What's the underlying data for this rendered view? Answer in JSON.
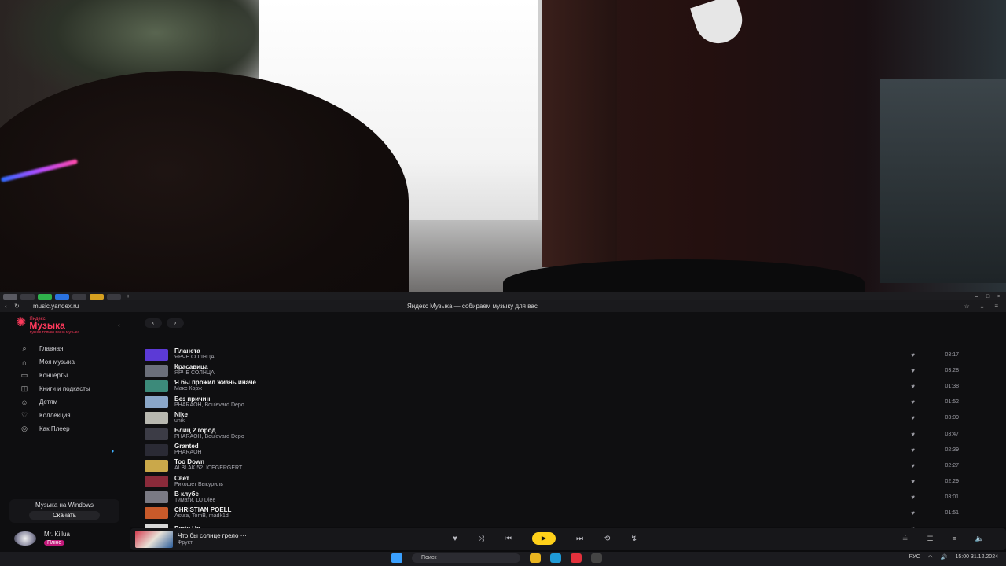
{
  "browser": {
    "url": "music.yandex.ru",
    "window_title": "Яндекс Музыка — собираем музыку для вас"
  },
  "sidebar": {
    "logo_small": "Яндекс",
    "logo_big": "Музыка",
    "logo_tagline": "лучше только ваша музыка",
    "items": [
      {
        "label": "Главная",
        "icon": "search-icon"
      },
      {
        "label": "Моя музыка",
        "icon": "headphones-icon"
      },
      {
        "label": "Концерты",
        "icon": "ticket-icon"
      },
      {
        "label": "Книги и подкасты",
        "icon": "book-icon"
      },
      {
        "label": "Детям",
        "icon": "kid-icon"
      },
      {
        "label": "Коллекция",
        "icon": "heart-icon"
      },
      {
        "label": "Как Плеер",
        "icon": "player-icon"
      }
    ],
    "promo_label": "Музыка на Windows",
    "promo_button": "Скачать",
    "user_name": "Mr. Killua",
    "user_badge": "Плюс"
  },
  "tracks": [
    {
      "title": "Планета",
      "artist": "ЯРЧЕ СОЛНЦА",
      "duration": "03:17",
      "color": "#5c3ad6"
    },
    {
      "title": "Красавица",
      "artist": "ЯРЧЕ СОЛНЦА",
      "duration": "03:28",
      "color": "#6b6f7a"
    },
    {
      "title": "Я бы прожил жизнь иначе",
      "artist": "Макс Корж",
      "duration": "01:38",
      "color": "#3c8a7a"
    },
    {
      "title": "Без причин",
      "artist": "PHARAOH, Boulevard Depo",
      "duration": "01:52",
      "color": "#8aa6c8"
    },
    {
      "title": "Nike",
      "artist": "uniki",
      "duration": "03:09",
      "color": "#b8b8b0"
    },
    {
      "title": "Блиц 2 город",
      "artist": "PHARAOH, Boulevard Depo",
      "duration": "03:47",
      "color": "#3c3c46"
    },
    {
      "title": "Granted",
      "artist": "PHARAOH",
      "duration": "02:39",
      "color": "#2a2a34"
    },
    {
      "title": "Too Down",
      "artist": "ALBLAK 52, ICEGERGERT",
      "duration": "02:27",
      "color": "#caa84a"
    },
    {
      "title": "Свет",
      "artist": "Рикошет Выкуриль",
      "duration": "02:29",
      "color": "#8a2a3a"
    },
    {
      "title": "В клубе",
      "artist": "Тимати, DJ Dlee",
      "duration": "03:01",
      "color": "#7a7a84"
    },
    {
      "title": "CHRISTIAN POELL",
      "artist": "Asura, TomB, madk1d",
      "duration": "01:51",
      "color": "#c85a2a"
    },
    {
      "title": "Party Up",
      "artist": "",
      "duration": "",
      "color": "#d8d8d8"
    }
  ],
  "player": {
    "title": "Что бы солнце грело",
    "artist": "Фрукт",
    "more": "···"
  },
  "taskbar": {
    "search_placeholder": "Поиск",
    "lang": "РУС",
    "time": "15:00",
    "date": "31.12.2024"
  }
}
